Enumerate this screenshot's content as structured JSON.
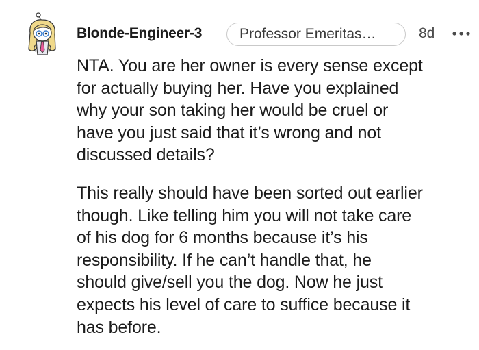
{
  "comment": {
    "username": "Blonde-Engineer-3",
    "flair": "Professor Emeritas…",
    "time": "8d",
    "more_icon": "more-horizontal-icon",
    "avatar_icon": "snoo-avatar-blonde",
    "paragraphs": [
      "NTA. You are her owner is every sense except\nfor actually buying her. Have you explained\nwhy your son taking her would be cruel or\nhave you just said that it’s wrong and not\ndiscussed details?",
      "This really should have been sorted out earlier\nthough. Like telling him you will not take care\nof his dog for 6 months because it’s his\nresponsibility. If he can’t handle that, he\nshould give/sell you the dog. Now he just\nexpects his level of care to suffice because it\nhas before."
    ]
  }
}
